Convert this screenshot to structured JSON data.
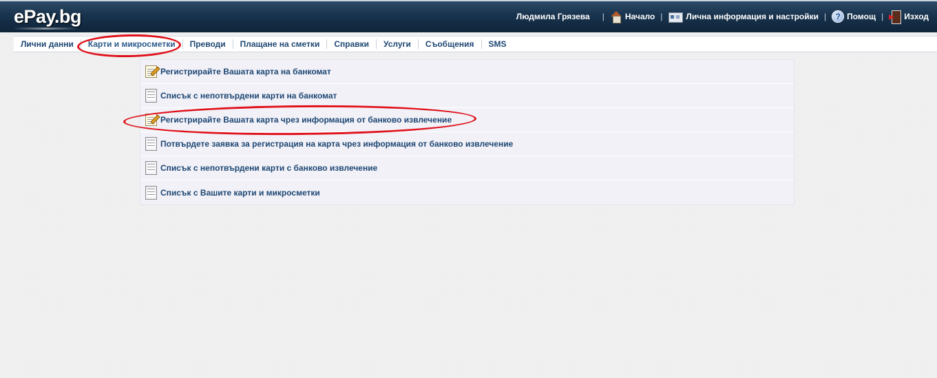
{
  "header": {
    "logo": "ePay.bg",
    "user_name": "Людмила Грязева",
    "links": [
      {
        "label": "Начало",
        "icon": "home-icon"
      },
      {
        "label": "Лична информация и настройки",
        "icon": "settings-card-icon"
      },
      {
        "label": "Помощ",
        "icon": "help-icon"
      },
      {
        "label": "Изход",
        "icon": "exit-icon"
      }
    ],
    "separator": "|"
  },
  "nav": {
    "items": [
      {
        "label": "Лични данни"
      },
      {
        "label": "Карти и микросметки",
        "active": true
      },
      {
        "label": "Преводи"
      },
      {
        "label": "Плащане на сметки"
      },
      {
        "label": "Справки"
      },
      {
        "label": "Услуги"
      },
      {
        "label": "Съобщения"
      },
      {
        "label": "SMS"
      }
    ]
  },
  "menu": {
    "items": [
      {
        "label": "Регистрирайте Вашата карта на банкомат",
        "icon": "edit-note-icon"
      },
      {
        "label": "Списък с непотвърдени карти на банкомат",
        "icon": "document-icon"
      },
      {
        "label": "Регистрирайте Вашата карта чрез информация от банково извлечение",
        "icon": "edit-note-icon"
      },
      {
        "label": "Потвърдете заявка за регистрация на карта чрез информация от банково извлечение",
        "icon": "document-icon"
      },
      {
        "label": "Списък с непотвърдени карти с банково извлечение",
        "icon": "document-icon"
      },
      {
        "label": "Списък с Вашите карти и микросметки",
        "icon": "document-icon"
      }
    ]
  },
  "colors": {
    "header_bg": "#1a3550",
    "link_text": "#1d4673",
    "highlight_oval": "#e0101a",
    "panel_bg": "#f1f1f7"
  }
}
